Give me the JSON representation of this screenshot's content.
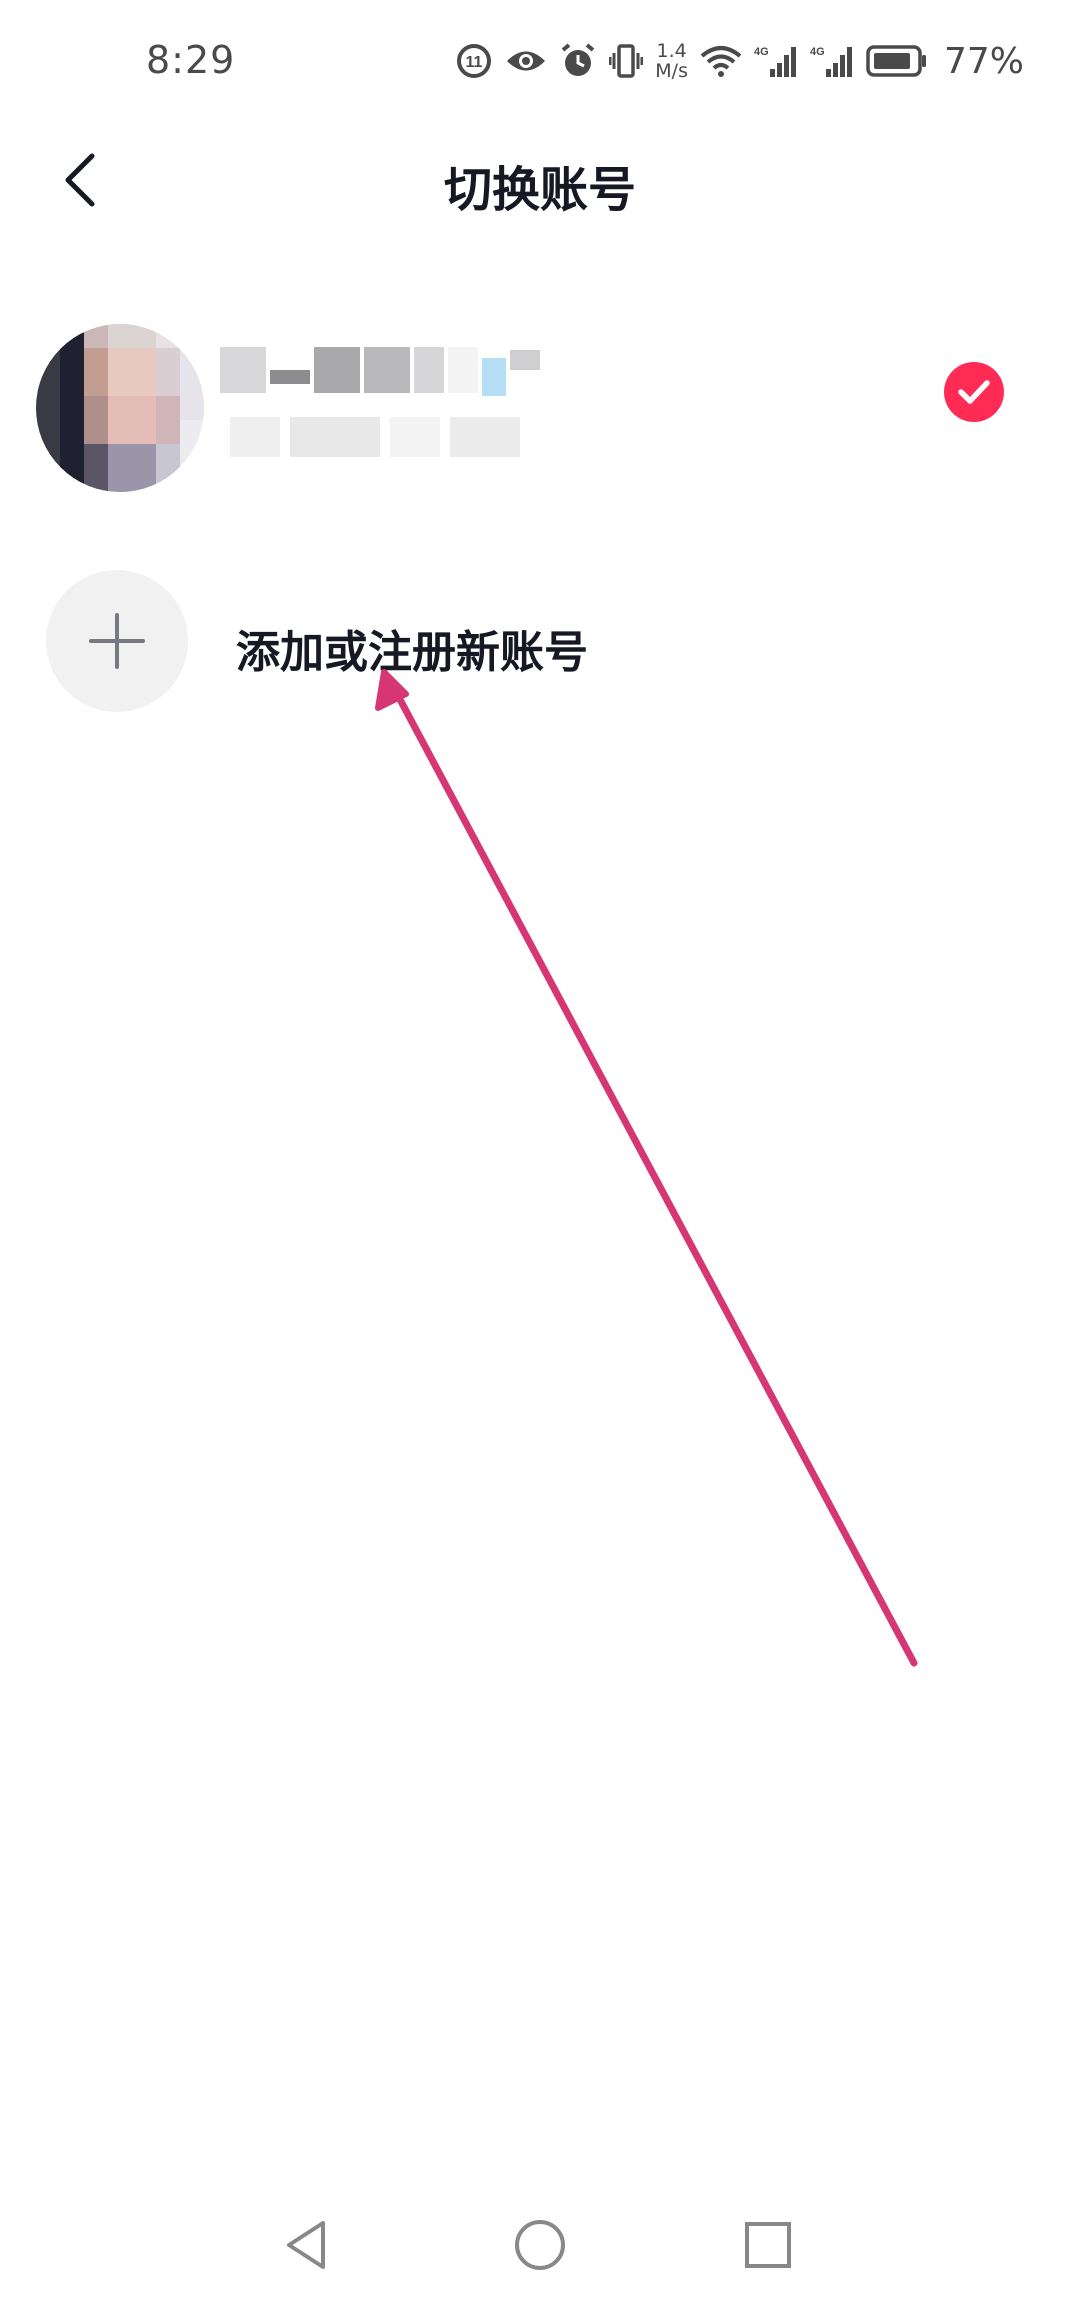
{
  "status_bar": {
    "time": "8:29",
    "net_speed_value": "1.4",
    "net_speed_unit": "M/s",
    "battery_percent": "77%",
    "icons": [
      "sync-icon",
      "eye-icon",
      "alarm-icon",
      "vibrate-icon",
      "wifi-icon",
      "signal-4g-icon",
      "signal-4g-icon",
      "battery-icon"
    ]
  },
  "header": {
    "title": "切换账号",
    "back_icon": "chevron-left-icon"
  },
  "current_account": {
    "selected": true,
    "check_icon": "check-circle-icon"
  },
  "add_account": {
    "label": "添加或注册新账号",
    "icon": "plus-icon"
  },
  "nav_bar": {
    "buttons": [
      "back-triangle-icon",
      "home-circle-icon",
      "recents-square-icon"
    ]
  },
  "colors": {
    "accent": "#fe2c55",
    "annotation_arrow": "#d63674",
    "text_primary": "#161823",
    "add_circle_bg": "#f1f1f2"
  }
}
